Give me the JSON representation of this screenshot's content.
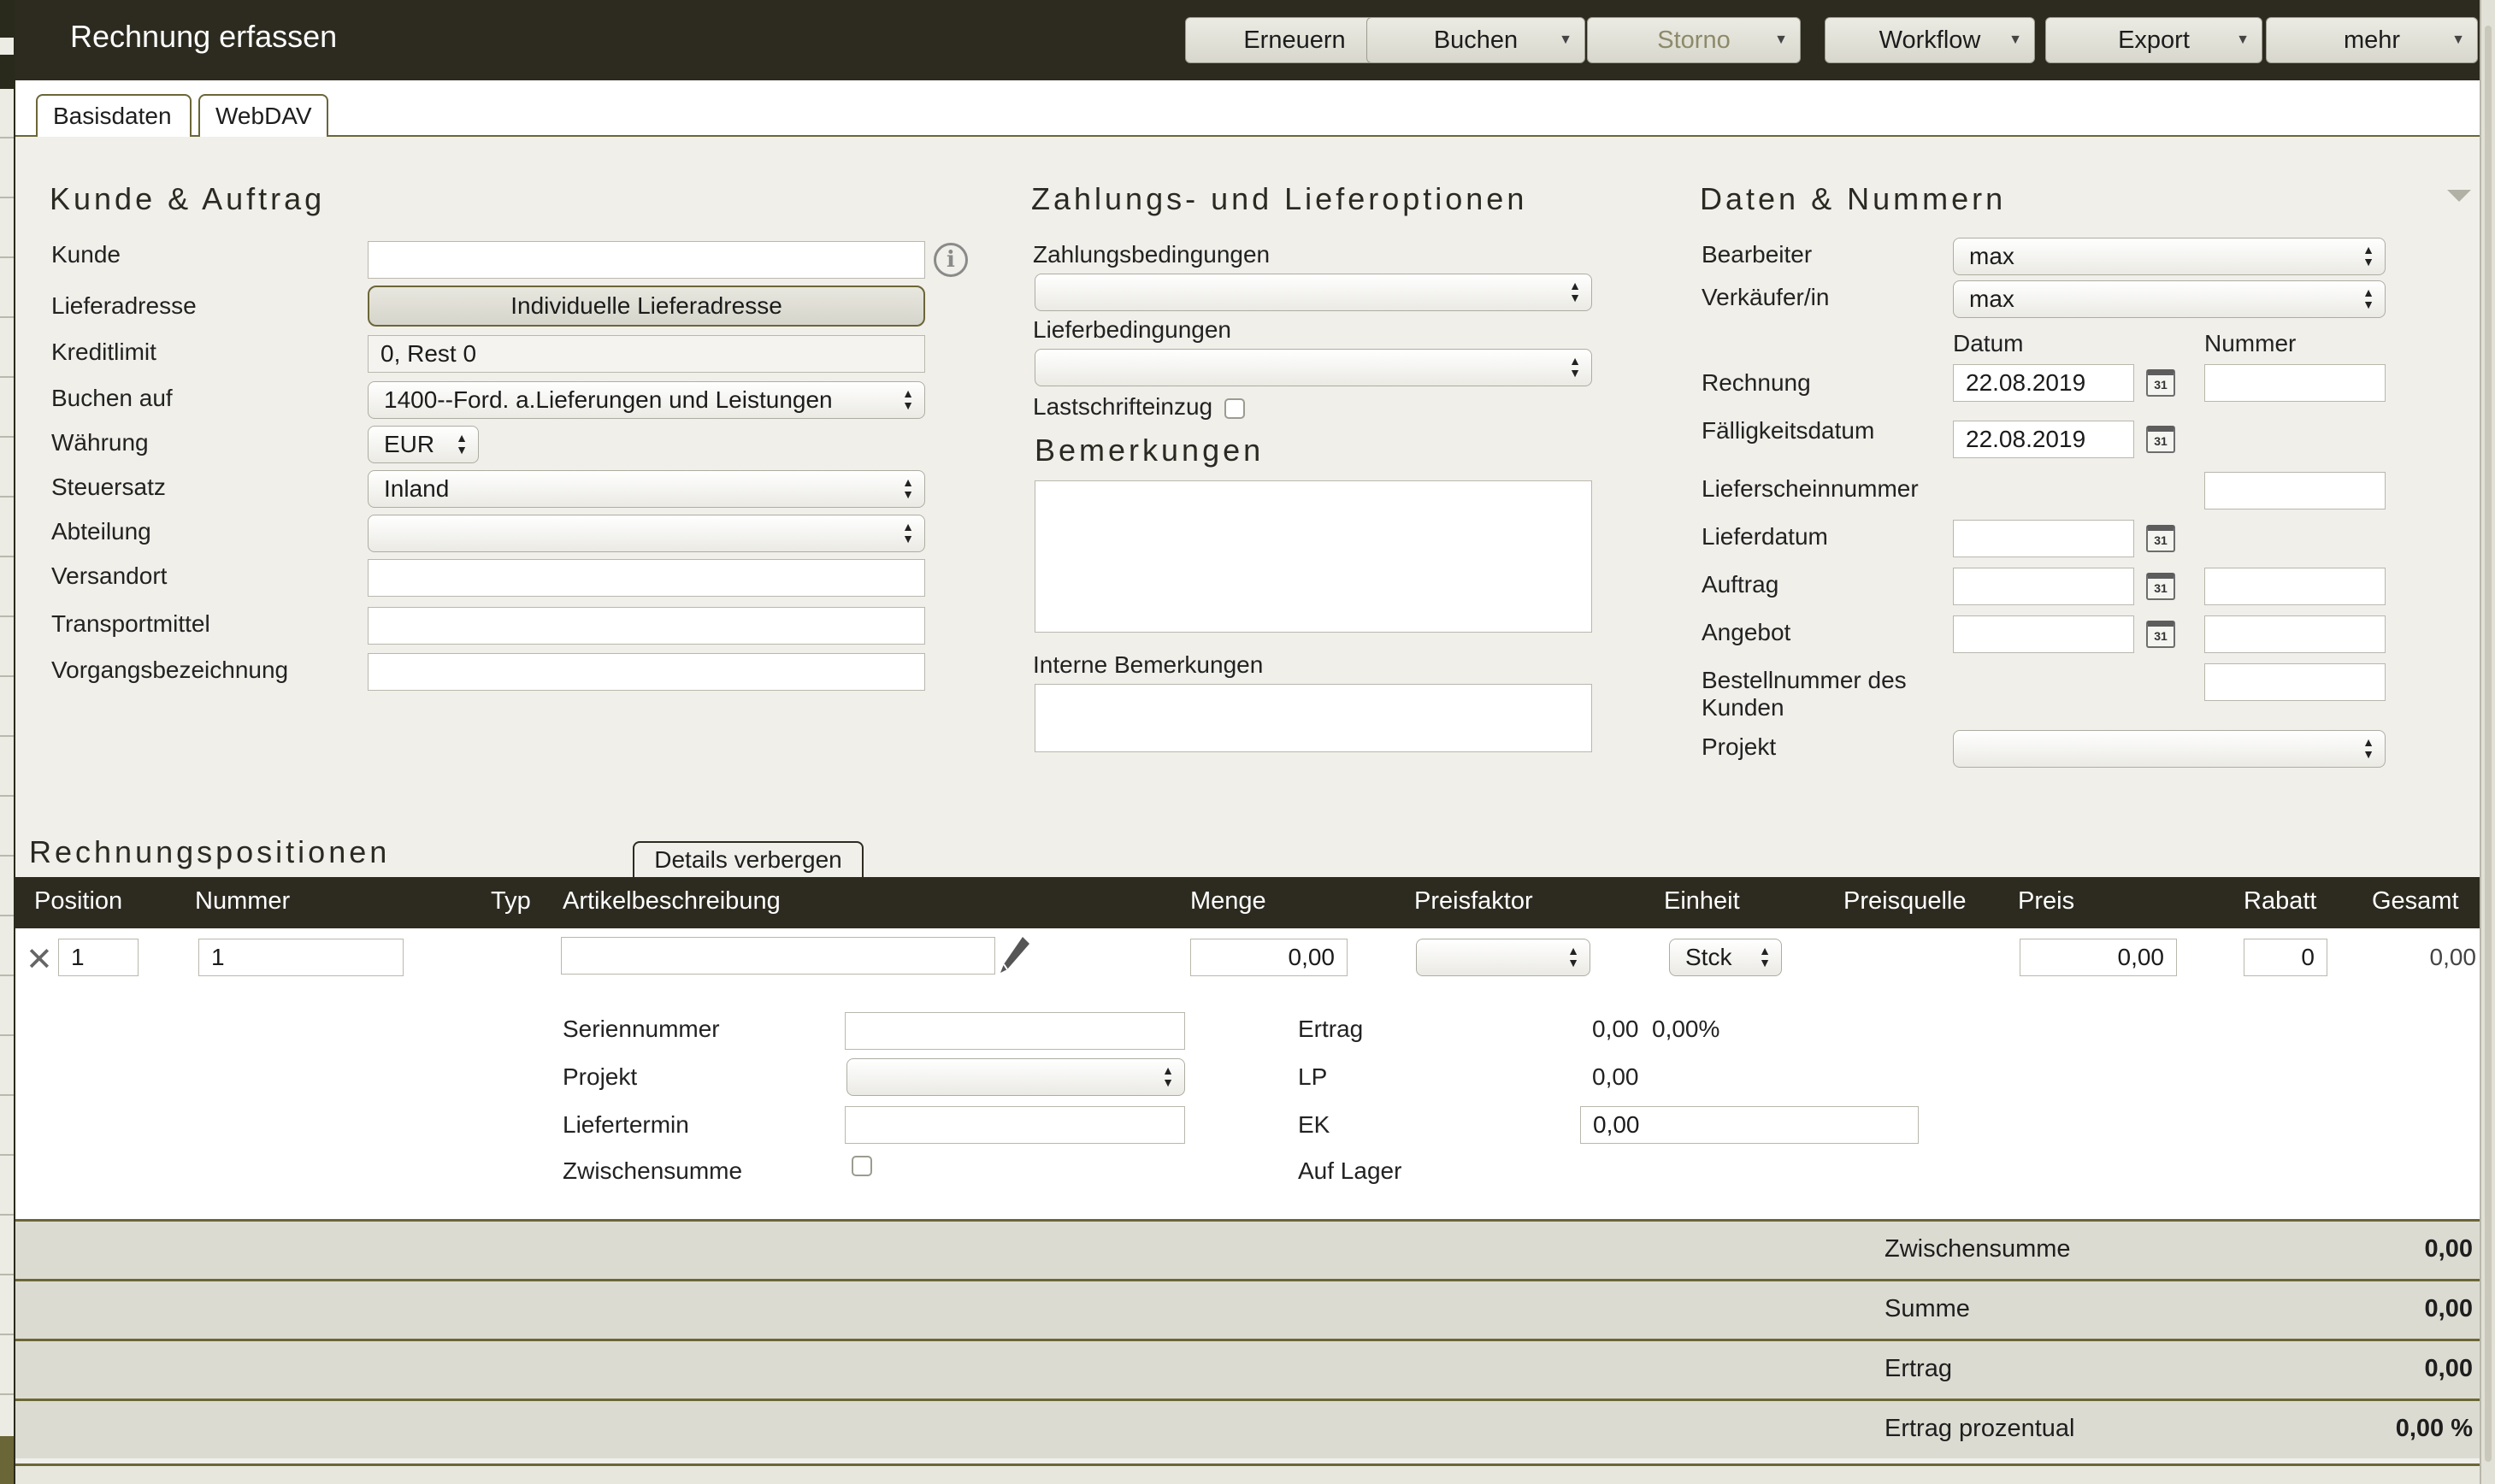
{
  "window": {
    "title": "Rechnung erfassen"
  },
  "toolbar": {
    "buttons": [
      {
        "label": "Erneuern"
      },
      {
        "label": "Buchen"
      },
      {
        "label": "Storno"
      },
      {
        "label": "Workflow"
      },
      {
        "label": "Export"
      },
      {
        "label": "mehr"
      }
    ]
  },
  "tabs": [
    {
      "label": "Basisdaten"
    },
    {
      "label": "WebDAV"
    }
  ],
  "kunde_auftrag": {
    "title": "Kunde & Auftrag",
    "kunde_label": "Kunde",
    "kunde_value": "",
    "lieferadresse_label": "Lieferadresse",
    "lieferadresse_button": "Individuelle Lieferadresse",
    "kreditlimit_label": "Kreditlimit",
    "kreditlimit_value": "0, Rest 0",
    "buchen_auf_label": "Buchen auf",
    "buchen_auf_value": "1400--Ford. a.Lieferungen und Leistungen",
    "waehrung_label": "Währung",
    "waehrung_value": "EUR",
    "steuersatz_label": "Steuersatz",
    "steuersatz_value": "Inland",
    "abteilung_label": "Abteilung",
    "abteilung_value": "",
    "versandort_label": "Versandort",
    "versandort_value": "",
    "transportmittel_label": "Transportmittel",
    "transportmittel_value": "",
    "vorgangsbezeichnung_label": "Vorgangsbezeichnung",
    "vorgangsbezeichnung_value": ""
  },
  "zahlung": {
    "title": "Zahlungs- und Lieferoptionen",
    "zahlungsbedingungen_label": "Zahlungsbedingungen",
    "zahlungsbedingungen_value": "",
    "lieferbedingungen_label": "Lieferbedingungen",
    "lieferbedingungen_value": "",
    "lastschrift_label": "Lastschrifteinzug",
    "bemerkungen_title": "Bemerkungen",
    "interne_label": "Interne Bemerkungen"
  },
  "daten": {
    "title": "Daten & Nummern",
    "bearbeiter_label": "Bearbeiter",
    "bearbeiter_value": "max",
    "verkaeufer_label": "Verkäufer/in",
    "verkaeufer_value": "max",
    "datum_header": "Datum",
    "nummer_header": "Nummer",
    "rechnung_label": "Rechnung",
    "rechnung_datum": "22.08.2019",
    "rechnung_nummer": "",
    "faellig_label": "Fälligkeitsdatum",
    "faellig_datum": "22.08.2019",
    "lieferschein_label": "Lieferscheinnummer",
    "lieferdatum_label": "Lieferdatum",
    "auftrag_label": "Auftrag",
    "angebot_label": "Angebot",
    "bestellnummer_label_1": "Bestellnummer des",
    "bestellnummer_label_2": "Kunden",
    "projekt_label": "Projekt",
    "projekt_value": "",
    "calendar_icon_text": "31"
  },
  "positionen": {
    "title": "Rechnungspositionen",
    "details_button": "Details verbergen",
    "columns": [
      "Position",
      "Nummer",
      "Typ",
      "Artikelbeschreibung",
      "Menge",
      "Preisfaktor",
      "Einheit",
      "Preisquelle",
      "Preis",
      "Rabatt",
      "Gesamt"
    ],
    "row": {
      "position": "1",
      "nummer": "1",
      "beschreibung": "",
      "menge": "0,00",
      "preisfaktor": "",
      "einheit": "Stck",
      "preis": "0,00",
      "rabatt": "0",
      "gesamt": "0,00"
    },
    "details": {
      "seriennummer_label": "Seriennummer",
      "projekt_label": "Projekt",
      "liefertermin_label": "Liefertermin",
      "zwischensumme_label": "Zwischensumme",
      "ertrag_label": "Ertrag",
      "ertrag_value": "0,00",
      "ertrag_percent": "0,00%",
      "lp_label": "LP",
      "lp_value": "0,00",
      "ek_label": "EK",
      "ek_value": "0,00",
      "auf_lager_label": "Auf Lager"
    }
  },
  "totals": [
    {
      "label": "Zwischensumme",
      "value": "0,00"
    },
    {
      "label": "Summe",
      "value": "0,00"
    },
    {
      "label": "Ertrag",
      "value": "0,00"
    },
    {
      "label": "Ertrag prozentual",
      "value": "0,00 %"
    }
  ],
  "icons": {
    "info": "info-icon",
    "calendar": "calendar-icon",
    "pencil": "pencil-icon",
    "delete": "delete-icon",
    "collapse": "collapse-triangle-icon"
  },
  "colors": {
    "titlebar": "#2d2b20",
    "accent": "#6b6637",
    "background": "#f0efea"
  }
}
